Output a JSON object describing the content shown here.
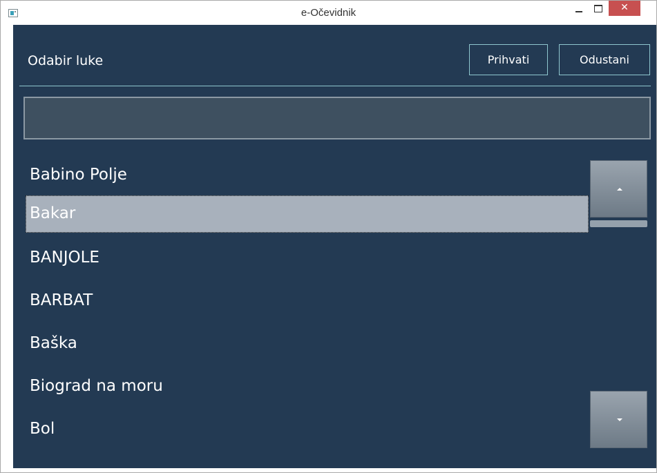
{
  "window": {
    "title": "e-Očevidnik",
    "close_glyph": "✕"
  },
  "header": {
    "title": "Odabir luke",
    "accept_label": "Prihvati",
    "cancel_label": "Odustani"
  },
  "search": {
    "value": ""
  },
  "list": {
    "items": [
      {
        "label": "Babino Polje",
        "selected": false
      },
      {
        "label": "Bakar",
        "selected": true
      },
      {
        "label": "BANJOLE",
        "selected": false
      },
      {
        "label": "BARBAT",
        "selected": false
      },
      {
        "label": "Baška",
        "selected": false
      },
      {
        "label": "Biograd na moru",
        "selected": false
      },
      {
        "label": "Bol",
        "selected": false
      }
    ]
  },
  "colors": {
    "background": "#233a53",
    "accent_border": "#8fc7cf",
    "selected_item": "#a8b1bc",
    "close_button": "#c75050"
  }
}
